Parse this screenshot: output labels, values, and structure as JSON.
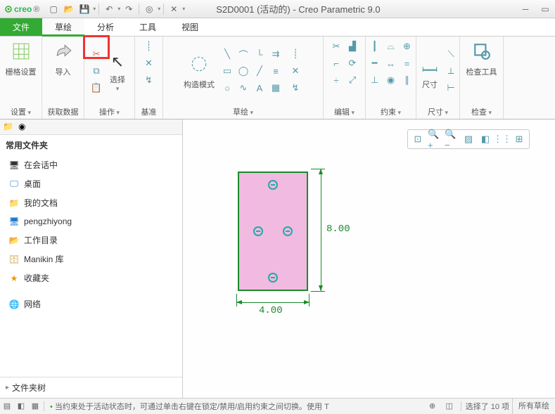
{
  "app": {
    "name": "creo",
    "title": "S2D0001 (活动的) - Creo Parametric 9.0"
  },
  "tabs": {
    "file": "文件",
    "sketch": "草绘",
    "analysis": "分析",
    "tools": "工具",
    "view": "视图"
  },
  "ribbon": {
    "grid": {
      "label": "栅格设置",
      "group": "设置"
    },
    "import": {
      "label": "导入",
      "group": "获取数据"
    },
    "select": {
      "label": "选择",
      "group": "操作"
    },
    "datum": {
      "group": "基准"
    },
    "construct": {
      "label": "构造模式",
      "group": "草绘"
    },
    "edit": {
      "group": "编辑"
    },
    "constraint": {
      "group": "约束"
    },
    "dimension": {
      "label": "尺寸",
      "group": "尺寸"
    },
    "inspect": {
      "label": "检查工具",
      "group": "检查"
    }
  },
  "sidebar": {
    "header": "常用文件夹",
    "items": [
      {
        "icon": "session",
        "label": "在会话中"
      },
      {
        "icon": "desktop",
        "label": "桌面"
      },
      {
        "icon": "mydocs",
        "label": "我的文档"
      },
      {
        "icon": "computer",
        "label": "pengzhiyong"
      },
      {
        "icon": "workdir",
        "label": "工作目录"
      },
      {
        "icon": "manikin",
        "label": "Manikin 库"
      },
      {
        "icon": "fav",
        "label": "收藏夹"
      },
      {
        "icon": "network",
        "label": "网络"
      }
    ],
    "footer": "文件夹树"
  },
  "chart_data": {
    "type": "sketch",
    "rectangle": {
      "width": 4.0,
      "height": 8.0
    },
    "holes": 4,
    "dimensions": {
      "width_label": "4.00",
      "height_label": "8.00"
    }
  },
  "status": {
    "msg": "当约束处于活动状态时，可通过单击右键在锁定/禁用/启用约束之间切换。使用 T",
    "selection": "选择了 10 项",
    "filter": "所有草绘"
  }
}
